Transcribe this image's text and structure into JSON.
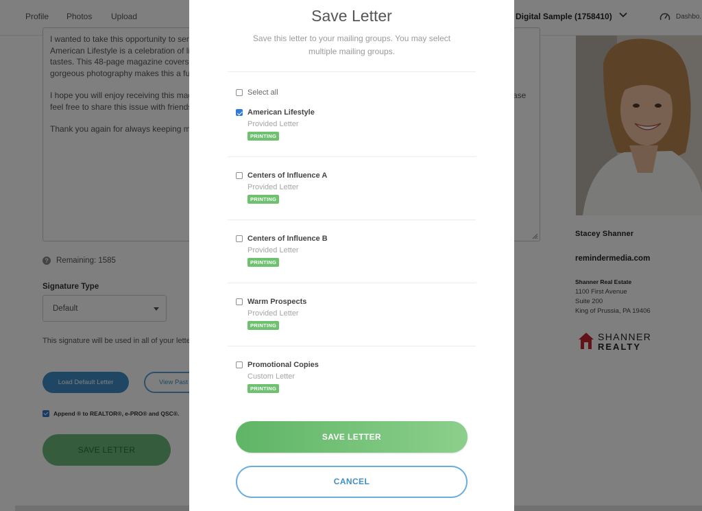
{
  "nav": {
    "links": [
      "Profile",
      "Photos",
      "Upload"
    ],
    "sample": "Digital Sample (1758410)",
    "dashboard": "Dashbo..."
  },
  "letter": {
    "paragraphs": [
      "I wanted to take this opportunity to send you a copy of this magazine and say thank you for your support, loyalty, and referrals. American Lifestyle is a celebration of living well. Each issue offers a chance to explore the nation's sights, sounds, smells, and tastes. This 48-page magazine covers a wide range of topics, including travel, food, and more. Entertaining writing coupled with gorgeous photography makes this a fun read.",
      "I hope you will enjoy receiving this magazine. It is a small token of my appreciation for your continued support and referrals. Please feel free to share this issue with friends and family.",
      "Thank you again for always keeping me in mind."
    ],
    "remaining": "Remaining: 1585"
  },
  "signature": {
    "label": "Signature Type",
    "value": "Default",
    "note": "This signature will be used in all of your letters."
  },
  "buttons": {
    "load_default": "Load Default Letter",
    "view_past": "View Past",
    "save": "SAVE LETTER"
  },
  "append": "Append ® to REALTOR®, e-PRO® and QSC®.",
  "profile": {
    "name": "Stacey Shanner",
    "website": "remindermedia.com",
    "company": "Shanner Real Estate",
    "address": [
      "1100 First Avenue",
      "Suite 200",
      "King of Prussia, PA 19406"
    ],
    "logo_line1": "SHANNER",
    "logo_line2": "REALTY"
  },
  "modal": {
    "title": "Save Letter",
    "description": "Save this letter to your mailing groups. You may select multiple mailing groups.",
    "select_all": "Select all",
    "groups": [
      {
        "name": "American Lifestyle",
        "subtitle": "Provided Letter",
        "badge": "PRINTING",
        "checked": true
      },
      {
        "name": "Centers of Influence A",
        "subtitle": "Provided Letter",
        "badge": "PRINTING",
        "checked": false
      },
      {
        "name": "Centers of Influence B",
        "subtitle": "Provided Letter",
        "badge": "PRINTING",
        "checked": false
      },
      {
        "name": "Warm Prospects",
        "subtitle": "Provided Letter",
        "badge": "PRINTING",
        "checked": false
      },
      {
        "name": "Promotional Copies",
        "subtitle": "Custom Letter",
        "badge": "PRINTING",
        "checked": false
      }
    ],
    "save_button": "SAVE LETTER",
    "cancel_button": "CANCEL"
  },
  "colors": {
    "primary_green": "#6ec26f",
    "primary_blue": "#3f8fc6",
    "checkbox_blue": "#2f7bd8",
    "logo_red": "#c4262e"
  }
}
